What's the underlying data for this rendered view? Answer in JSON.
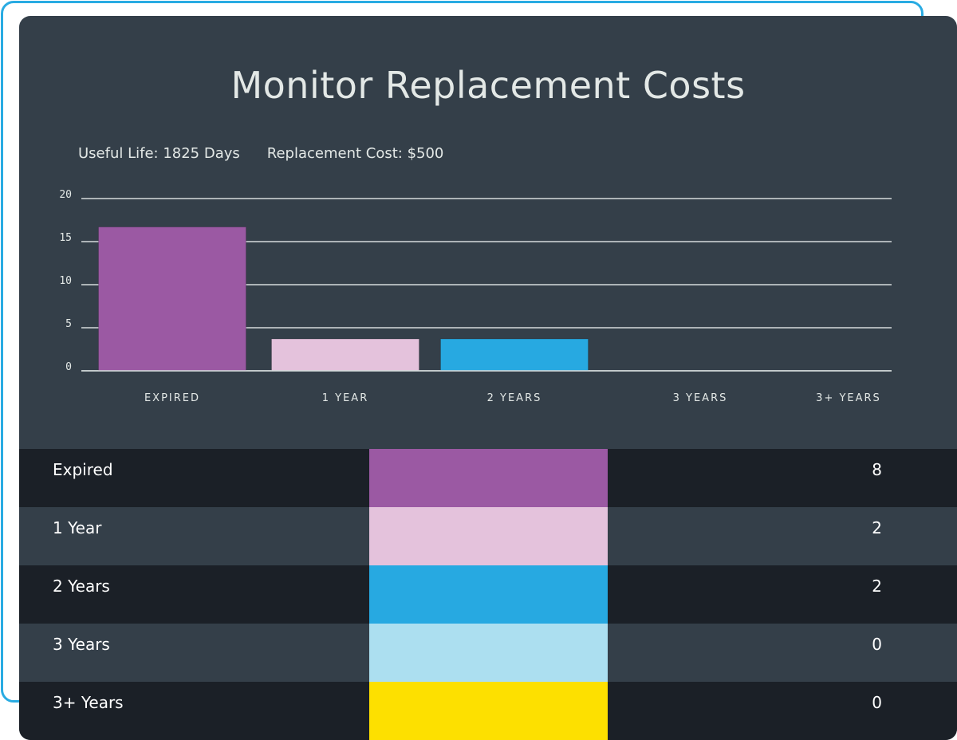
{
  "title": "Monitor Replacement Costs",
  "meta": {
    "useful_life": "Useful Life: 1825 Days",
    "replacement_cost": "Replacement Cost: $500"
  },
  "chart_data": {
    "type": "bar",
    "title": "Monitor Replacement Costs",
    "xlabel": "",
    "ylabel": "",
    "categories": [
      "EXPIRED",
      "1 YEAR",
      "2 YEARS",
      "3 YEARS",
      "3+ YEARS"
    ],
    "values": [
      16.7,
      3.7,
      3.7,
      0,
      0
    ],
    "colors": [
      "#9b59a3",
      "#e4c2dc",
      "#27a9e1",
      "#acdff0",
      "#fde000"
    ],
    "yticks": [
      0,
      5,
      10,
      15,
      20
    ],
    "ylim": [
      0,
      20
    ],
    "grid": true,
    "legend": "none"
  },
  "table": {
    "rows": [
      {
        "label": "Expired",
        "count": "8",
        "color": "#9b59a3"
      },
      {
        "label": "1 Year",
        "count": "2",
        "color": "#e4c2dc"
      },
      {
        "label": "2 Years",
        "count": "2",
        "color": "#27a9e1"
      },
      {
        "label": "3 Years",
        "count": "0",
        "color": "#acdff0"
      },
      {
        "label": "3+ Years",
        "count": "0",
        "color": "#fde000"
      }
    ]
  }
}
